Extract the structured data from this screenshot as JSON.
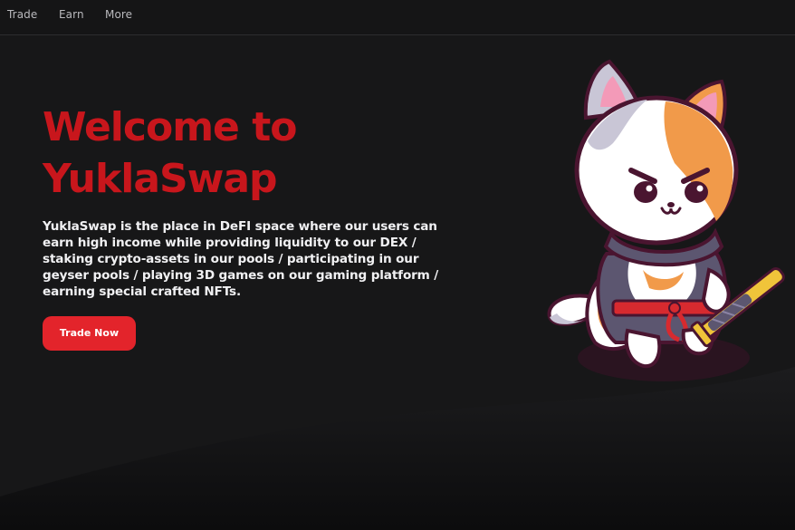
{
  "nav": {
    "items": [
      {
        "label": "Trade"
      },
      {
        "label": "Earn"
      },
      {
        "label": "More"
      }
    ]
  },
  "hero": {
    "title": "Welcome to YuklaSwap",
    "description": "YuklaSwap is the place in DeFI space where our users can earn high income while providing liquidity to our DEX / staking crypto-assets in our pools / participating in our geyser pools / playing 3D games on our gaming platform / earning special crafted NFTs.",
    "cta_label": "Trade Now"
  },
  "colors": {
    "background": "#161617",
    "title": "#c8161c",
    "cta": "#e3242b",
    "text": "#f1f1f3",
    "nav_text": "#b9b9bd"
  },
  "mascot": {
    "icon": "samurai-cat-mascot-icon"
  }
}
